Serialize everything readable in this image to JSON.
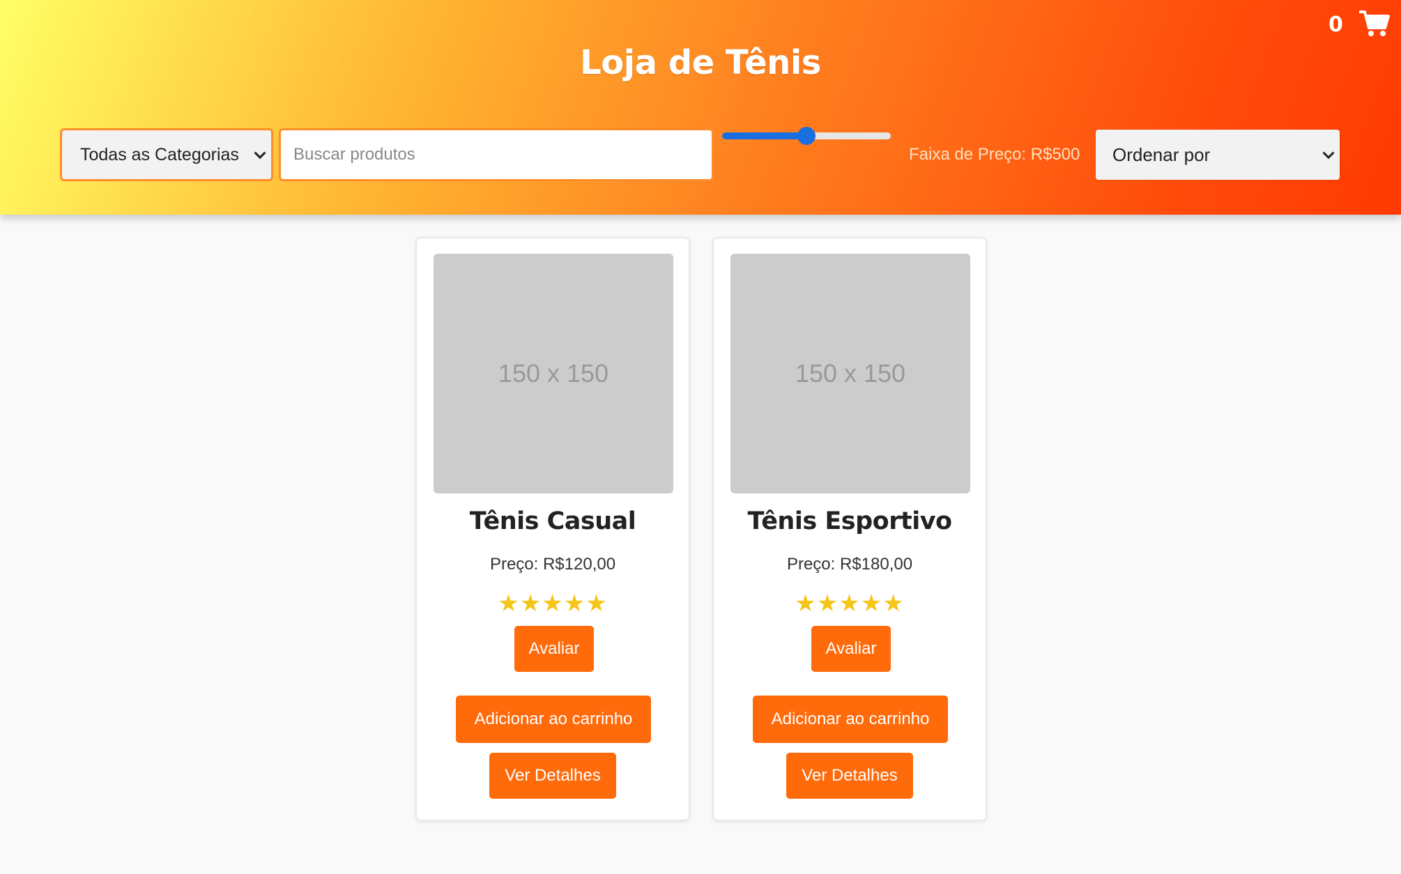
{
  "header": {
    "title": "Loja de Tênis",
    "cart_count": "0",
    "cart_icon": "shopping-cart-icon",
    "gradient_colors": [
      "#ffff66",
      "#ff7f1f",
      "#ff3a00"
    ]
  },
  "filters": {
    "category_selected": "Todas as Categorias",
    "search_placeholder": "Buscar produtos",
    "search_value": "",
    "price_slider_fraction": 0.5,
    "price_label": "Faixa de Preço: R$500",
    "order_selected": "Ordenar por"
  },
  "products": [
    {
      "image_label": "150 x 150",
      "name": "Tênis Casual",
      "price": "Preço: R$120,00",
      "rating": 5,
      "stars": "★★★★★",
      "rate_label": "Avaliar",
      "add_to_cart_label": "Adicionar ao carrinho",
      "details_label": "Ver Detalhes"
    },
    {
      "image_label": "150 x 150",
      "name": "Tênis Esportivo",
      "price": "Preço: R$180,00",
      "rating": 5,
      "stars": "★★★★★",
      "rate_label": "Avaliar",
      "add_to_cart_label": "Adicionar ao carrinho",
      "details_label": "Ver Detalhes"
    }
  ],
  "colors": {
    "accent": "#ff6a0a",
    "slider": "#1a6fe0",
    "star": "#f5c518"
  }
}
